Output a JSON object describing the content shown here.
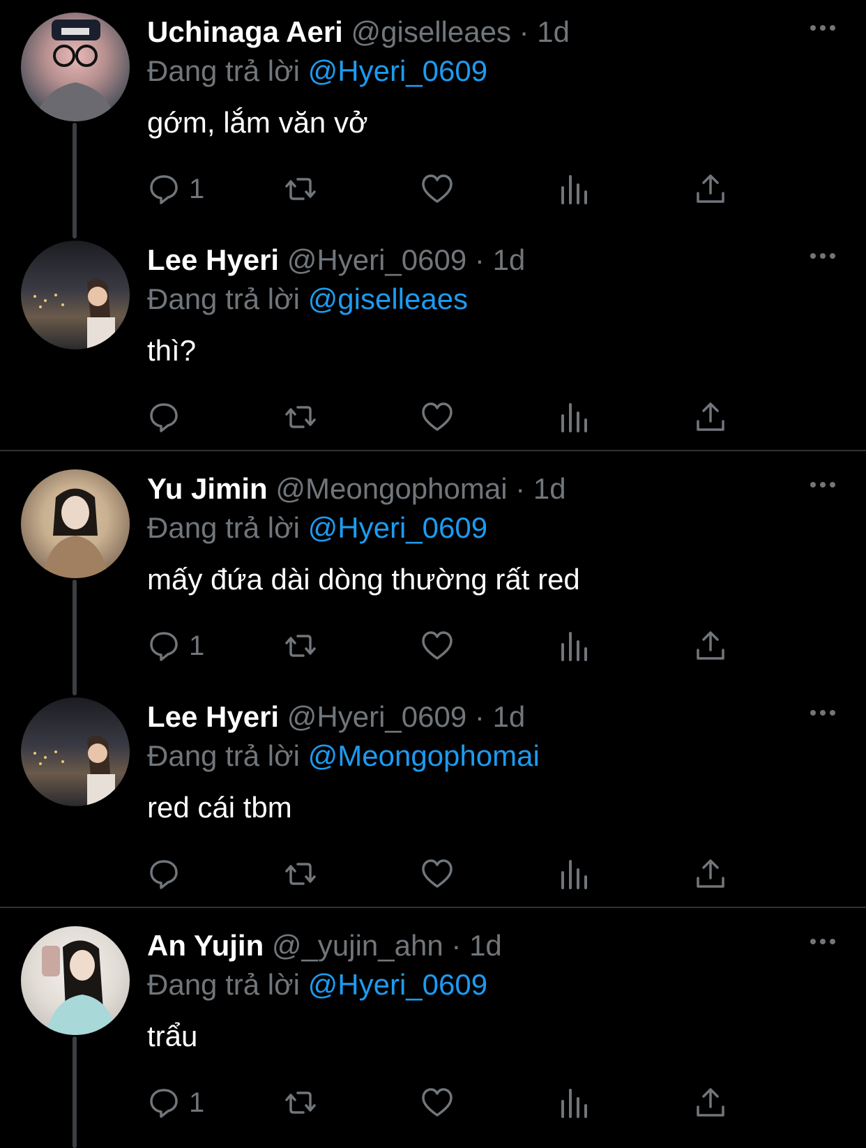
{
  "reply_prefix": "Đang trả lời",
  "colors": {
    "background": "#000000",
    "accent": "#1d9bf0",
    "muted": "#71767b",
    "text": "#ffffff"
  },
  "tweets": [
    {
      "name": "Uchinaga Aeri",
      "handle": "@giselleaes",
      "sep": "·",
      "time": "1d",
      "reply_to": "@Hyeri_0609",
      "text": "gớm, lắm văn vở",
      "reply_count": "1"
    },
    {
      "name": "Lee Hyeri",
      "handle": "@Hyeri_0609",
      "sep": "·",
      "time": "1d",
      "reply_to": "@giselleaes",
      "text": "thì?",
      "reply_count": ""
    },
    {
      "name": "Yu Jimin",
      "handle": "@Meongophomai",
      "sep": "·",
      "time": "1d",
      "reply_to": "@Hyeri_0609",
      "text": "mấy đứa dài dòng thường rất red",
      "reply_count": "1"
    },
    {
      "name": "Lee Hyeri",
      "handle": "@Hyeri_0609",
      "sep": "·",
      "time": "1d",
      "reply_to": "@Meongophomai",
      "text": "red cái tbm",
      "reply_count": ""
    },
    {
      "name": "An Yujin",
      "handle": "@_yujin_ahn",
      "sep": "·",
      "time": "1d",
      "reply_to": "@Hyeri_0609",
      "text": "trẩu",
      "reply_count": "1"
    }
  ]
}
